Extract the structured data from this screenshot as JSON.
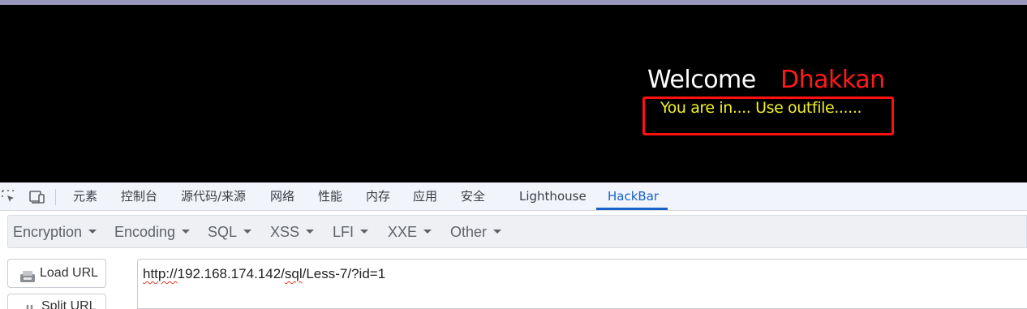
{
  "page": {
    "welcome": "Welcome",
    "username": "Dhakkan",
    "message": "You are in.... Use outfile......"
  },
  "devtools": {
    "icons": [
      "inspect-element-icon",
      "device-toolbar-icon"
    ],
    "tabs": [
      "元素",
      "控制台",
      "源代码/来源",
      "网络",
      "性能",
      "内存",
      "应用",
      "安全",
      "Lighthouse",
      "HackBar"
    ],
    "active_tab": "HackBar",
    "accent_color": "#1a62c6"
  },
  "hackbar": {
    "menus": [
      "Encryption",
      "Encoding",
      "SQL",
      "XSS",
      "LFI",
      "XXE",
      "Other"
    ],
    "buttons": {
      "load_url": "Load URL",
      "split_url": "Split URL"
    },
    "url": {
      "prefix": "http://",
      "host": "192.168.174.142/",
      "sql": "sql",
      "rest": "/Less-7/?id=1"
    }
  }
}
